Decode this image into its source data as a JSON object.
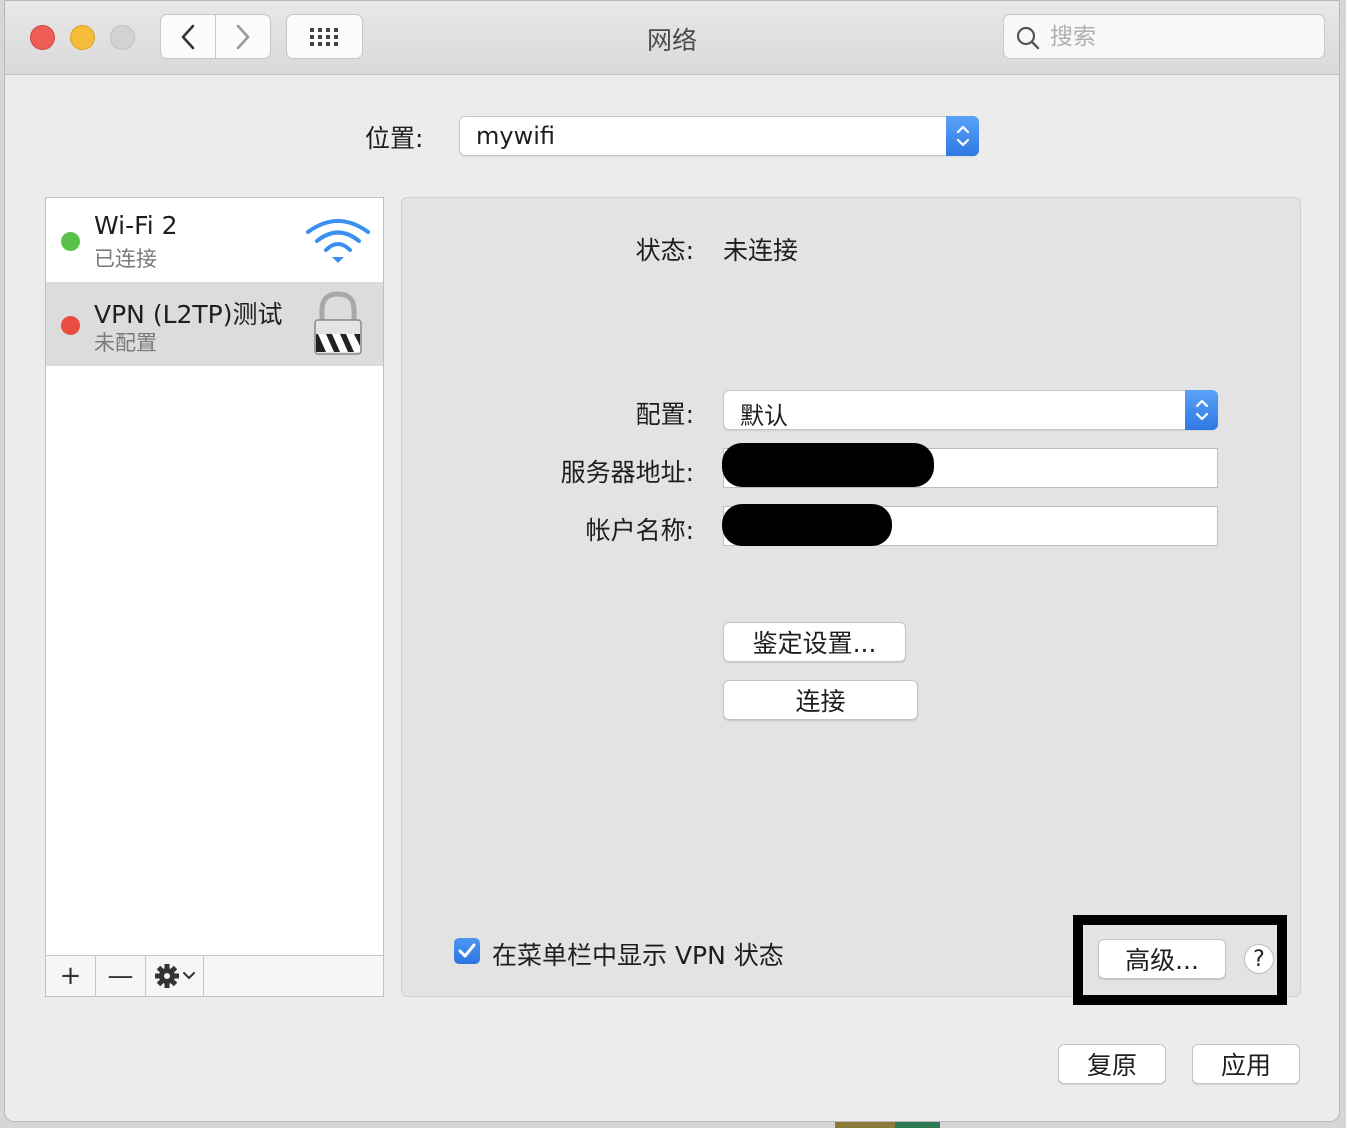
{
  "window": {
    "title": "网络",
    "search_placeholder": "搜索"
  },
  "location": {
    "label": "位置:",
    "value": "mywifi"
  },
  "services": [
    {
      "name": "Wi-Fi 2",
      "status": "已连接",
      "dot_color": "#5ac24a",
      "icon": "wifi-icon"
    },
    {
      "name": "VPN (L2TP)测试",
      "status": "未配置",
      "dot_color": "#ea4c3f",
      "icon": "lock-icon"
    }
  ],
  "sidebar_tools": {
    "add": "+",
    "remove": "—"
  },
  "detail": {
    "status_label": "状态:",
    "status_value": "未连接",
    "config_label": "配置:",
    "config_value": "默认",
    "server_label": "服务器地址:",
    "server_value": "",
    "account_label": "帐户名称:",
    "account_value": "",
    "auth_button": "鉴定设置...",
    "connect_button": "连接",
    "show_vpn_label": "在菜单栏中显示 VPN 状态",
    "show_vpn_checked": true,
    "advanced_button": "高级...",
    "help_button": "?"
  },
  "footer": {
    "revert_button": "复原",
    "apply_button": "应用"
  },
  "colors": {
    "accent": "#2f78e4"
  }
}
